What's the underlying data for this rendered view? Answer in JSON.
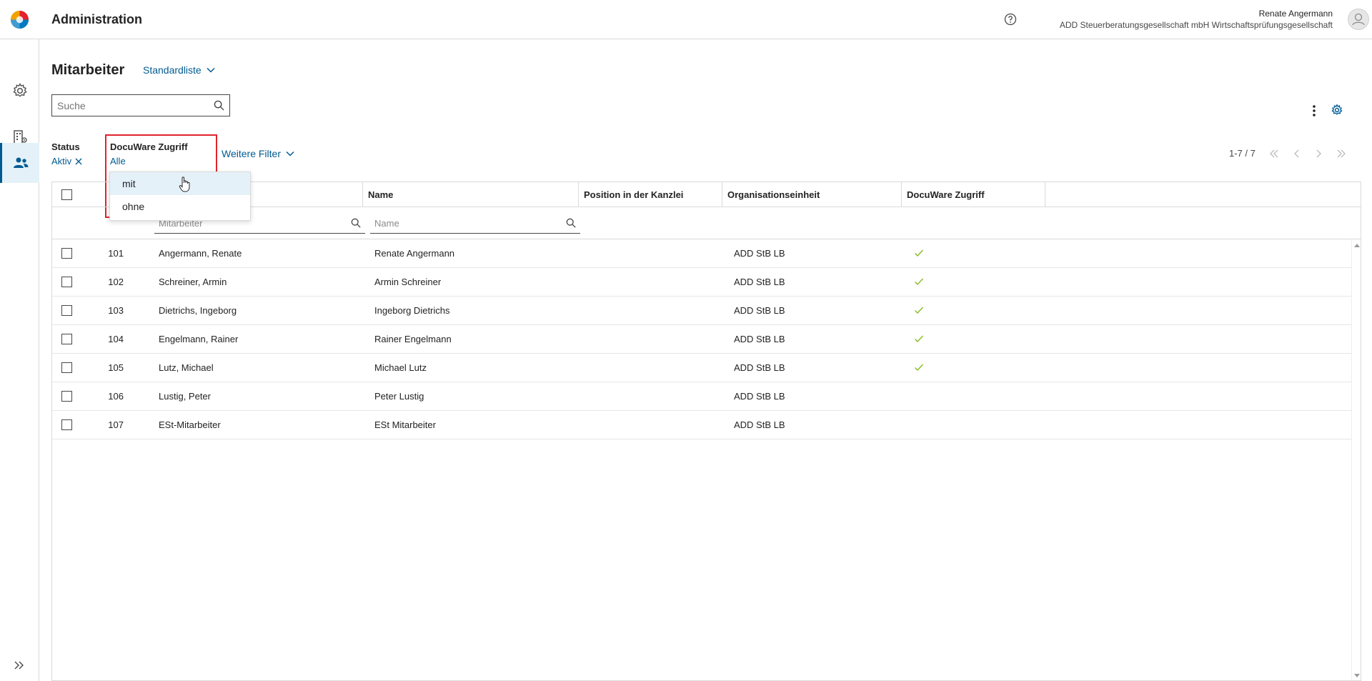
{
  "app": {
    "title": "Administration"
  },
  "user": {
    "name": "Renate Angermann",
    "company": "ADD Steuerberatungsgesellschaft mbH Wirtschaftsprüfungsgesellschaft"
  },
  "page": {
    "title": "Mitarbeiter",
    "view": "Standardliste"
  },
  "search": {
    "placeholder": "Suche"
  },
  "filters": {
    "status": {
      "label": "Status",
      "value": "Aktiv"
    },
    "docuware": {
      "label": "DocuWare Zugriff",
      "value": "Alle",
      "options": [
        "mit",
        "ohne"
      ]
    },
    "more": "Weitere Filter"
  },
  "pager": {
    "range": "1-7 / 7"
  },
  "table": {
    "columns": [
      "Name",
      "Position in der Kanzlei",
      "Organisationseinheit",
      "DocuWare Zugriff"
    ],
    "filter_placeholders": {
      "mitarbeiter": "Mitarbeiter",
      "name": "Name"
    },
    "rows": [
      {
        "nr": "101",
        "mitarbeiter": "Angermann, Renate",
        "name": "Renate Angermann",
        "position": "",
        "org": "ADD StB LB",
        "docuware": true
      },
      {
        "nr": "102",
        "mitarbeiter": "Schreiner, Armin",
        "name": "Armin Schreiner",
        "position": "",
        "org": "ADD StB LB",
        "docuware": true
      },
      {
        "nr": "103",
        "mitarbeiter": "Dietrichs, Ingeborg",
        "name": "Ingeborg Dietrichs",
        "position": "",
        "org": "ADD StB LB",
        "docuware": true
      },
      {
        "nr": "104",
        "mitarbeiter": "Engelmann, Rainer",
        "name": "Rainer Engelmann",
        "position": "",
        "org": "ADD StB LB",
        "docuware": true
      },
      {
        "nr": "105",
        "mitarbeiter": "Lutz, Michael",
        "name": "Michael Lutz",
        "position": "",
        "org": "ADD StB LB",
        "docuware": true
      },
      {
        "nr": "106",
        "mitarbeiter": "Lustig, Peter",
        "name": "Peter Lustig",
        "position": "",
        "org": "ADD StB LB",
        "docuware": false
      },
      {
        "nr": "107",
        "mitarbeiter": "ESt-Mitarbeiter",
        "name": "ESt Mitarbeiter",
        "position": "",
        "org": "ADD StB LB",
        "docuware": false
      }
    ]
  },
  "colors": {
    "accent": "#005b92",
    "highlight": "#e0242c",
    "check": "#85bc20"
  }
}
